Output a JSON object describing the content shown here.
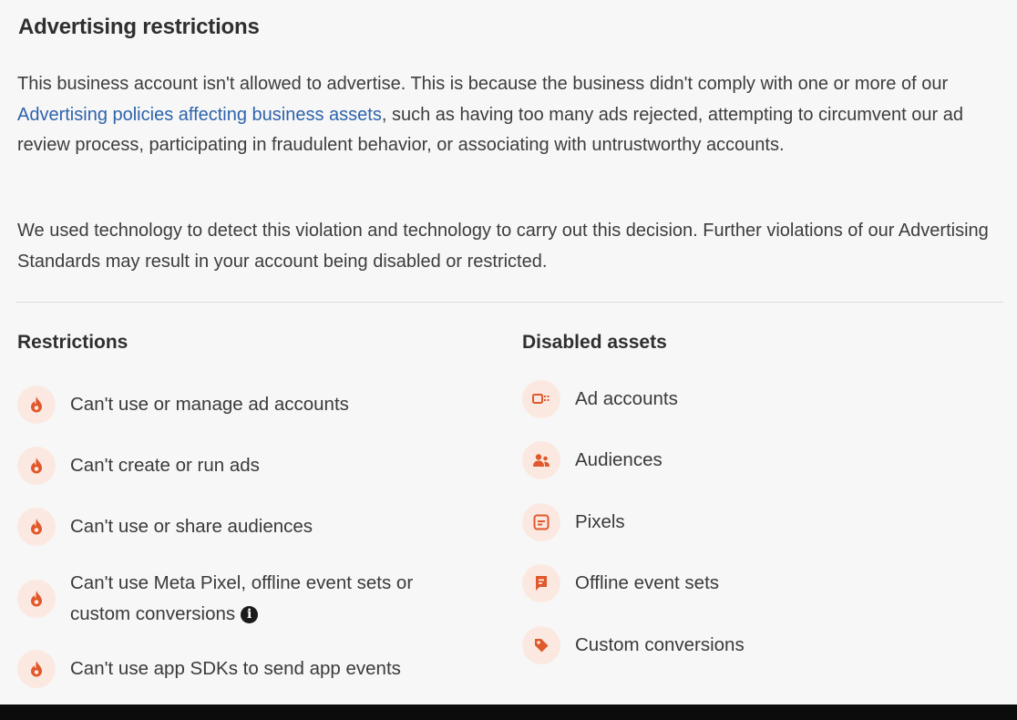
{
  "section": {
    "title": "Advertising restrictions",
    "paragraph1_before_link": "This business account isn't allowed to advertise. This is because the business didn't comply with one or more of our ",
    "paragraph1_link": "Advertising policies affecting business assets",
    "paragraph1_after_link": ", such as having too many ads rejected, attempting to circumvent our ad review process, participating in fraudulent behavior, or associating with untrustworthy accounts.",
    "paragraph2": "We used technology to detect this violation and technology to carry out this decision. Further violations of our Advertising Standards may result in your account being disabled or restricted."
  },
  "restrictions": {
    "heading": "Restrictions",
    "items": [
      {
        "label": "Can't use or manage ad accounts",
        "icon": "flame-icon"
      },
      {
        "label": "Can't create or run ads",
        "icon": "flame-icon"
      },
      {
        "label": "Can't use or share audiences",
        "icon": "flame-icon"
      },
      {
        "label": "Can't use Meta Pixel, offline event sets or custom conversions",
        "icon": "flame-icon"
      },
      {
        "label": "Can't use app SDKs to send app events",
        "icon": "flame-icon"
      }
    ],
    "info_icon": "i"
  },
  "disabled_assets": {
    "heading": "Disabled assets",
    "items": [
      {
        "label": "Ad accounts",
        "icon": "ad-account-icon"
      },
      {
        "label": "Audiences",
        "icon": "audience-icon"
      },
      {
        "label": "Pixels",
        "icon": "pixel-icon"
      },
      {
        "label": "Offline event sets",
        "icon": "offline-event-icon"
      },
      {
        "label": "Custom conversions",
        "icon": "custom-conversion-icon"
      }
    ]
  },
  "colors": {
    "accent": "#e0582b",
    "icon_bg": "#fbe9e1",
    "link": "#2e63ab"
  }
}
